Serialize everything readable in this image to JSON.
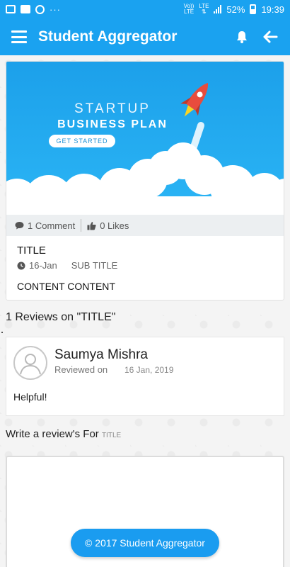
{
  "status_bar": {
    "more_dots": "···",
    "network_top": "Vo))",
    "network_bottom": "LTE",
    "lte_label": "LTE",
    "battery": "52%",
    "time": "19:39"
  },
  "app_bar": {
    "title": "Student Aggregator",
    "menu_icon": "hamburger-icon",
    "bell_icon": "bell-icon",
    "back_icon": "arrow-left-icon"
  },
  "post": {
    "banner": {
      "line1": "STARTUP",
      "line2": "BUSINESS PLAN",
      "cta": "GET STARTED"
    },
    "comments": "1 Comment",
    "likes": "0 Likes",
    "title": "TITLE",
    "date": "16-Jan",
    "subtitle": "SUB TITLE",
    "content": "CONTENT CONTENT"
  },
  "reviews": {
    "heading": "1 Reviews on \"TITLE\"",
    "items": [
      {
        "name": "Saumya Mishra",
        "reviewed_on_label": "Reviewed on",
        "date": "16 Jan, 2019",
        "text": "Helpful!"
      }
    ]
  },
  "write_review": {
    "label": "Write a review's For",
    "post_title": "TITLE",
    "value": ""
  },
  "footer": {
    "copyright": "© 2017 Student Aggregator"
  },
  "colors": {
    "primary": "#1aa2f0",
    "card_meta_bg": "#eceff1"
  }
}
